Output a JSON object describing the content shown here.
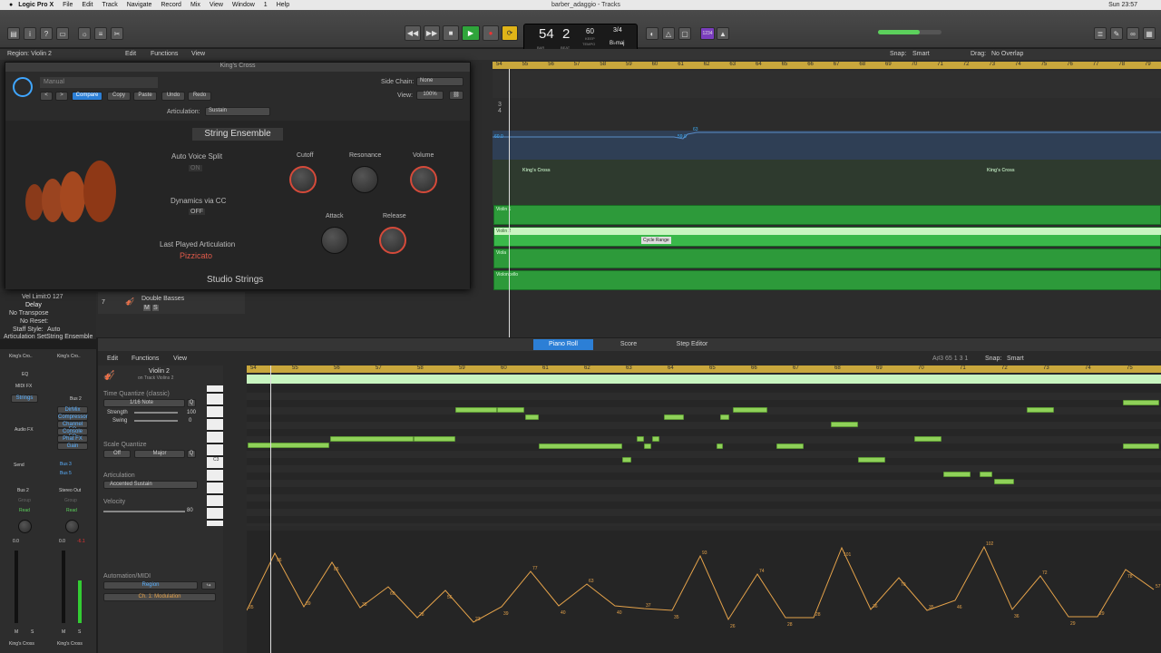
{
  "menubar": {
    "app": "Logic Pro X",
    "items": [
      "File",
      "Edit",
      "Track",
      "Navigate",
      "Record",
      "Mix",
      "View",
      "Window",
      "1",
      "Help"
    ],
    "window_title": "barber_adaggio - Tracks",
    "clock": "Sun 23:57"
  },
  "lcd": {
    "bar": "54",
    "beat": "2",
    "bar_label": "BAR",
    "beat_label": "BEAT",
    "tempo": "60",
    "tempo_label": "TEMPO",
    "keep": "KEEP",
    "time_sig": "3/4",
    "key": "B♭maj"
  },
  "transport": {
    "rewind": "◀◀",
    "forward": "▶▶",
    "stop": "■",
    "play": "▶",
    "record": "●",
    "cycle": "⟳"
  },
  "top_ruler": {
    "ticks": [
      "54",
      "55",
      "56",
      "57",
      "58",
      "59",
      "60",
      "61",
      "62",
      "63",
      "64",
      "65",
      "66",
      "67",
      "68",
      "69",
      "70",
      "71",
      "72",
      "73",
      "74",
      "75",
      "76",
      "77",
      "78",
      "79"
    ]
  },
  "tracks_header": {
    "region": "Region: Violin 2",
    "edit": "Edit",
    "functions": "Functions",
    "view": "View",
    "snap_label": "Snap:",
    "snap": "Smart",
    "drag_label": "Drag:",
    "drag": "No Overlap"
  },
  "plugin": {
    "title": "King's Cross",
    "preset": "Manual",
    "compare": "Compare",
    "copy": "Copy",
    "paste": "Paste",
    "undo": "Undo",
    "redo": "Redo",
    "side_chain_label": "Side Chain:",
    "side_chain": "None",
    "view_label": "View:",
    "view": "100%",
    "articulation_label": "Articulation:",
    "articulation": "Sustain",
    "instrument": "String Ensemble",
    "auto_voice_split": "Auto Voice Split",
    "auto_voice_value": "ON",
    "dynamics": "Dynamics via CC",
    "dynamics_value": "OFF",
    "last_played": "Last Played Articulation",
    "last_value": "Pizzicato",
    "cutoff": "Cutoff",
    "resonance": "Resonance",
    "volume": "Volume",
    "attack": "Attack",
    "release": "Release",
    "footer": "Studio Strings"
  },
  "arrange": {
    "regions": [
      {
        "name": "King's Cross"
      },
      {
        "name": "King's Cross"
      }
    ],
    "midi": [
      {
        "name": "Violin 1"
      },
      {
        "name": "Violin 2"
      },
      {
        "name": "Viola"
      },
      {
        "name": "Violoncello"
      }
    ],
    "cycle": "Cycle Range",
    "auto_val1": "60.0",
    "auto_val2": "59.0",
    "auto_val3": "63",
    "sig": "3\n4"
  },
  "left_track": {
    "num": "7",
    "name": "Double Basses",
    "m": "M",
    "s": "S",
    "vel": "Vel Limit:",
    "vel_value": "0  127",
    "delay": "Delay",
    "no_transpose": "No Transpose",
    "no_reset": "No Reset:",
    "staff_style": "Staff Style:",
    "staff_value": "Auto",
    "artic_set": "Articulation Set:",
    "artic_value": "String Ensemble"
  },
  "channel": {
    "strip1": "King's Cro..",
    "strip2": "King's Cro..",
    "eq": "EQ",
    "midi_fx": "MIDI FX",
    "strings": "Strings",
    "audio_fx": "Audio FX",
    "bus2": "Bus 2",
    "plugins": [
      "DirMix",
      "Compressor",
      "Channel EQ",
      "Console EQ",
      "Phat FX",
      "Gain"
    ],
    "send": "Send",
    "bus3": "Bus 3",
    "bus5": "Bus 5",
    "out1": "Bus 2",
    "out2": "Stereo Out",
    "group": "Group",
    "read": "Read",
    "vol1": "0.0",
    "vol2": "0.0",
    "vol3": "-6.1",
    "m": "M",
    "s": "S",
    "name1": "King's Cross",
    "name2": "King's Cross"
  },
  "editor": {
    "tabs": [
      "Piano Roll",
      "Score",
      "Step Editor"
    ],
    "edit": "Edit",
    "functions": "Functions",
    "view": "View",
    "snap_label": "Snap:",
    "snap": "Smart",
    "pos": "A♯3  65 1 3 1",
    "region": "Violin 2",
    "track": "on Track Violins 2",
    "tq": "Time Quantize (classic)",
    "tq_value": "1/16 Note",
    "strength": "Strength",
    "strength_value": "100",
    "swing": "Swing",
    "swing_value": "0",
    "sq": "Scale Quantize",
    "sq_off": "Off",
    "sq_major": "Major",
    "artic": "Articulation",
    "artic_value": "Accented Sustain",
    "velocity": "Velocity",
    "velocity_value": "80",
    "automation": "Automation/MIDI",
    "region_btn": "Region",
    "cc": "Ch. 1: Modulation",
    "c3": "C3",
    "q": "Q",
    "ticks": [
      "54",
      "55",
      "56",
      "57",
      "58",
      "59",
      "60",
      "61",
      "62",
      "63",
      "64",
      "65",
      "66",
      "67",
      "68",
      "69",
      "70",
      "71",
      "72",
      "73",
      "74",
      "75"
    ],
    "auto_labels": [
      "35",
      "96",
      "39",
      "86",
      "38",
      "60",
      "28",
      "56",
      "23",
      "39",
      "77",
      "40",
      "63",
      "40",
      "37",
      "35",
      "93",
      "26",
      "74",
      "28",
      "28",
      "101",
      "36",
      "70",
      "35",
      "46",
      "102",
      "36",
      "72",
      "29",
      "29",
      "78",
      "57"
    ]
  }
}
